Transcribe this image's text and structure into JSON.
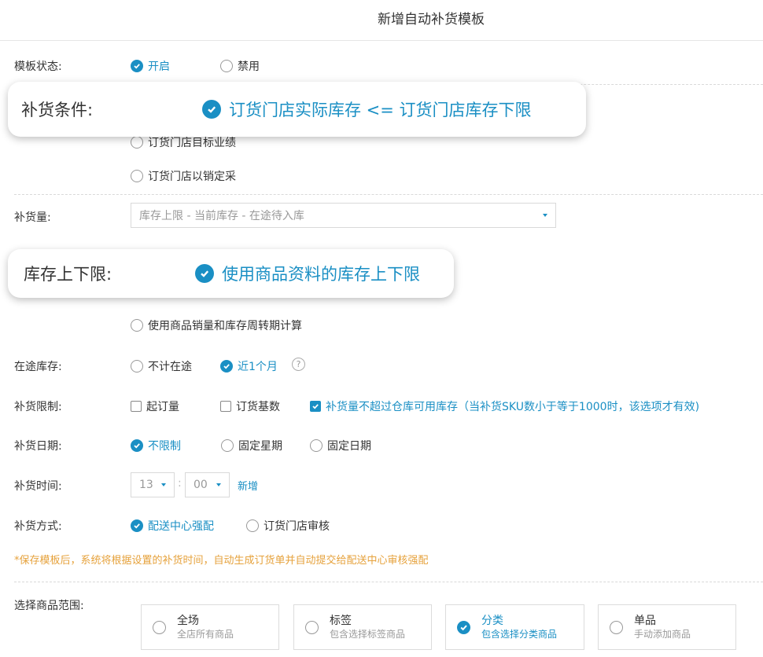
{
  "header": {
    "title": "新增自动补货模板"
  },
  "template_status": {
    "label": "模板状态:",
    "options": [
      {
        "label": "开启",
        "selected": true
      },
      {
        "label": "禁用",
        "selected": false
      }
    ]
  },
  "replenish_condition": {
    "popup_label": "补货条件:",
    "popup_value": "订货门店实际库存 <= 订货门店库存下限",
    "options": [
      {
        "label": "订货门店目标业绩",
        "selected": false
      },
      {
        "label": "订货门店以销定采",
        "selected": false
      }
    ]
  },
  "replenish_qty": {
    "label": "补货量:",
    "value": "库存上限 - 当前库存 - 在途待入库"
  },
  "stock_limits": {
    "popup_label": "库存上下限:",
    "popup_value": "使用商品资料的库存上下限",
    "options": [
      {
        "label": "使用商品销量和库存周转期计算",
        "selected": false
      }
    ]
  },
  "in_transit": {
    "label": "在途库存:",
    "options": [
      {
        "label": "不计在途",
        "selected": false
      },
      {
        "label": "近1个月",
        "selected": true
      }
    ],
    "help": "?"
  },
  "replenish_limit": {
    "label": "补货限制:",
    "options": [
      {
        "label": "起订量",
        "checked": false
      },
      {
        "label": "订货基数",
        "checked": false
      },
      {
        "label": "补货量不超过仓库可用库存（当补货SKU数小于等于1000时，该选项才有效)",
        "checked": true
      }
    ]
  },
  "replenish_date": {
    "label": "补货日期:",
    "options": [
      {
        "label": "不限制",
        "selected": true
      },
      {
        "label": "固定星期",
        "selected": false
      },
      {
        "label": "固定日期",
        "selected": false
      }
    ]
  },
  "replenish_time": {
    "label": "补货时间:",
    "hour": "13",
    "separator": ":",
    "minute": "00",
    "add_label": "新增"
  },
  "replenish_method": {
    "label": "补货方式:",
    "options": [
      {
        "label": "配送中心强配",
        "selected": true
      },
      {
        "label": "订货门店审核",
        "selected": false
      }
    ]
  },
  "note": "*保存模板后，系统将根据设置的补货时间，自动生成订货单并自动提交给配送中心审核强配",
  "product_scope": {
    "label": "选择商品范围:",
    "cards": [
      {
        "title": "全场",
        "sub": "全店所有商品",
        "selected": false
      },
      {
        "title": "标签",
        "sub": "包含选择标签商品",
        "selected": false
      },
      {
        "title": "分类",
        "sub": "包含选择分类商品",
        "selected": true
      },
      {
        "title": "单品",
        "sub": "手动添加商品",
        "selected": false
      }
    ]
  },
  "colors": {
    "accent": "#1a8fc4",
    "warning": "#e6a23c",
    "text": "#333333",
    "muted": "#999999"
  }
}
